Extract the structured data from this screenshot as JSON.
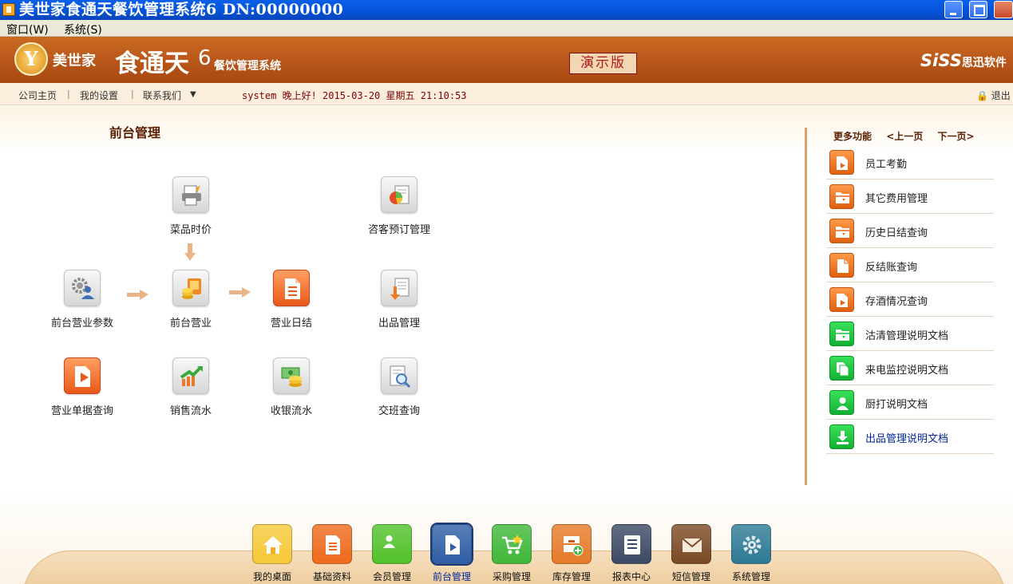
{
  "window": {
    "title": "美世家食通天餐饮管理系统6  DN:00000000"
  },
  "menubar": {
    "items": [
      "窗口(W)",
      "系统(S)"
    ]
  },
  "banner": {
    "brand": "美世家",
    "product": "食通天",
    "version": "6",
    "subtitle": "餐饮管理系统",
    "demo_badge": "演示版",
    "company": "SiSS",
    "company_cn": "思迅软件"
  },
  "navrow": {
    "links": [
      "公司主页",
      "我的设置",
      "联系我们"
    ],
    "status": "system 晚上好! 2015-03-20 星期五 21:10:53",
    "logout": "退出"
  },
  "section": {
    "title": "前台管理"
  },
  "functions": [
    {
      "label": "菜品时价",
      "icon": "printer-icon"
    },
    {
      "label": "咨客预订管理",
      "icon": "pie-chart-icon"
    },
    {
      "label": "前台营业参数",
      "icon": "settings-user-icon"
    },
    {
      "label": "前台营业",
      "icon": "coins-icon"
    },
    {
      "label": "营业日结",
      "icon": "document-icon"
    },
    {
      "label": "出品管理",
      "icon": "download-doc-icon"
    },
    {
      "label": "营业单据查询",
      "icon": "bill-search-icon"
    },
    {
      "label": "销售流水",
      "icon": "trend-up-icon"
    },
    {
      "label": "收银流水",
      "icon": "money-icon"
    },
    {
      "label": "交班查询",
      "icon": "magnifier-doc-icon"
    }
  ],
  "more": {
    "title": "更多功能",
    "prev": "<上一页",
    "next": "下一页>",
    "items": [
      {
        "label": "员工考勤",
        "color": "#e8651a",
        "icon": "doc-arrow-icon"
      },
      {
        "label": "其它费用管理",
        "color": "#e8651a",
        "icon": "folder-icon"
      },
      {
        "label": "历史日结查询",
        "color": "#e8651a",
        "icon": "folder-icon"
      },
      {
        "label": "反结账查询",
        "color": "#e8651a",
        "icon": "doc-icon"
      },
      {
        "label": "存酒情况查询",
        "color": "#e8651a",
        "icon": "doc-arrow-icon"
      },
      {
        "label": "沽清管理说明文档",
        "color": "#1cc03a",
        "icon": "folder-icon"
      },
      {
        "label": "来电监控说明文档",
        "color": "#1cc03a",
        "icon": "copy-icon"
      },
      {
        "label": "厨打说明文档",
        "color": "#1cc03a",
        "icon": "user-icon"
      },
      {
        "label": "出品管理说明文档",
        "color": "#1cc03a",
        "icon": "download-icon"
      }
    ]
  },
  "dock": {
    "items": [
      {
        "label": "我的桌面",
        "color": "#f6c93a",
        "icon": "home-icon"
      },
      {
        "label": "基础资料",
        "color": "#ee6a1e",
        "icon": "document-icon"
      },
      {
        "label": "会员管理",
        "color": "#52c22c",
        "icon": "user-icon"
      },
      {
        "label": "前台管理",
        "color": "#2e5fa8",
        "icon": "doc-arrow-icon",
        "active": true
      },
      {
        "label": "采购管理",
        "color": "#3fb83a",
        "icon": "cart-icon"
      },
      {
        "label": "库存管理",
        "color": "#e57a2a",
        "icon": "box-icon"
      },
      {
        "label": "报表中心",
        "color": "#3b4a66",
        "icon": "report-icon"
      },
      {
        "label": "短信管理",
        "color": "#7a4a26",
        "icon": "mail-icon"
      },
      {
        "label": "系统管理",
        "color": "#2d7a96",
        "icon": "gear-icon"
      }
    ]
  }
}
